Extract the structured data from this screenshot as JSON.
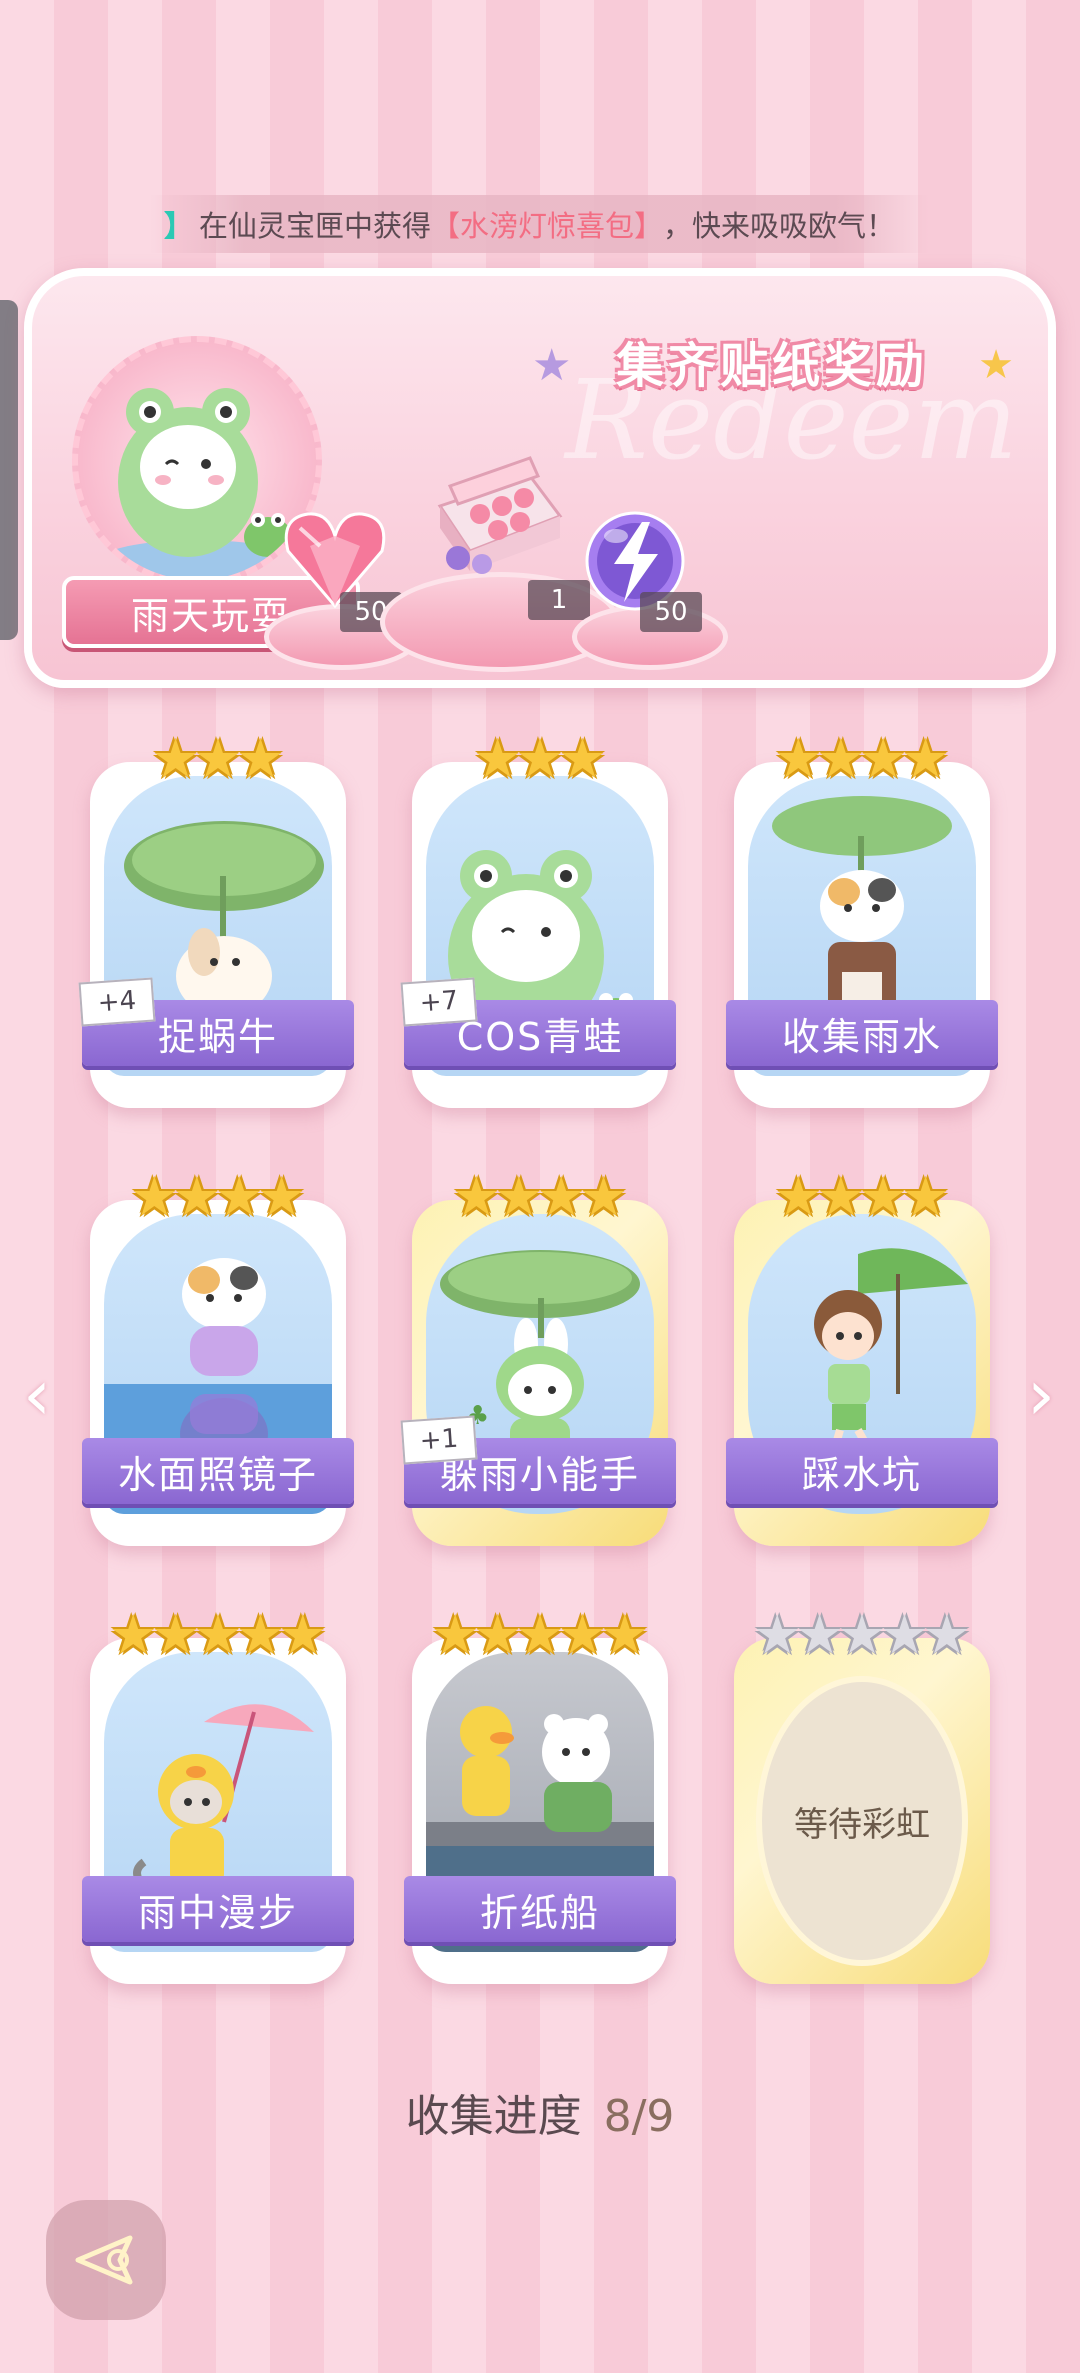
{
  "marquee": {
    "bracket": "】",
    "prefix": "在仙灵宝匣中获得",
    "item": "【水滂灯惊喜包】",
    "suffix": "，快来吸吸欧气！"
  },
  "reward": {
    "title": "集齐贴纸奖励",
    "watermark": "Redeem",
    "hero_label": "雨天玩耍",
    "items": [
      {
        "icon": "pink-heart-gem-icon",
        "count": "50"
      },
      {
        "icon": "gift-box-icon",
        "count": "1"
      },
      {
        "icon": "purple-lightning-orb-icon",
        "count": "50"
      }
    ]
  },
  "cards": [
    {
      "label": "捉蜗牛",
      "stars": 3,
      "max_stars": 3,
      "badge": "+4",
      "rarity": "normal",
      "collected": true
    },
    {
      "label": "COS青蛙",
      "stars": 3,
      "max_stars": 3,
      "badge": "+7",
      "rarity": "normal",
      "collected": true
    },
    {
      "label": "收集雨水",
      "stars": 4,
      "max_stars": 4,
      "badge": "",
      "rarity": "normal",
      "collected": true
    },
    {
      "label": "水面照镜子",
      "stars": 4,
      "max_stars": 4,
      "badge": "",
      "rarity": "normal",
      "collected": true
    },
    {
      "label": "躲雨小能手",
      "stars": 4,
      "max_stars": 4,
      "badge": "+1",
      "rarity": "gold",
      "collected": true
    },
    {
      "label": "踩水坑",
      "stars": 4,
      "max_stars": 4,
      "badge": "",
      "rarity": "gold",
      "collected": true
    },
    {
      "label": "雨中漫步",
      "stars": 5,
      "max_stars": 5,
      "badge": "",
      "rarity": "normal",
      "collected": true
    },
    {
      "label": "折纸船",
      "stars": 5,
      "max_stars": 5,
      "badge": "",
      "rarity": "normal",
      "collected": true
    },
    {
      "label": "等待彩虹",
      "stars": 0,
      "max_stars": 5,
      "badge": "",
      "rarity": "gold",
      "collected": false
    }
  ],
  "progress": {
    "label": "收集进度",
    "value": "8/9"
  },
  "nav": {
    "left": "‹",
    "right": "›"
  },
  "colors": {
    "accent": "#8a67d1",
    "pink": "#f08aa6",
    "gold": "#f9c73d"
  }
}
